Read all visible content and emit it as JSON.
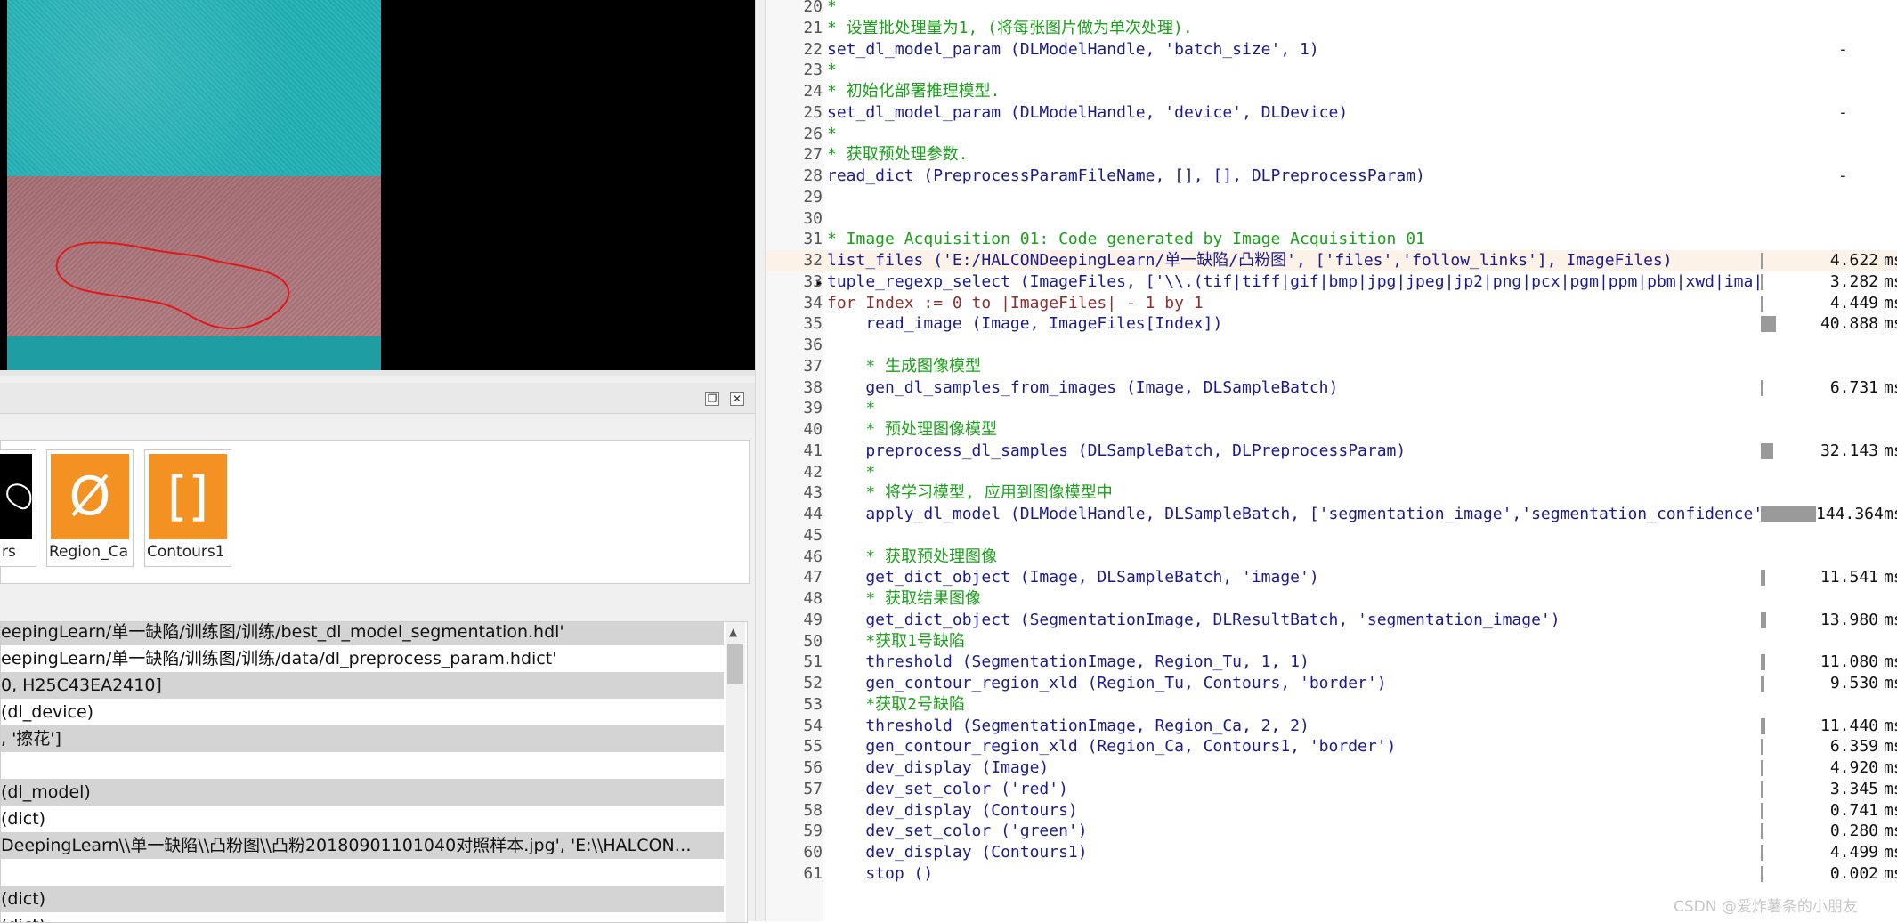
{
  "graphics_window": {
    "contour_color": "#e01818"
  },
  "variable_window": {
    "iconic_variables": [
      {
        "label": "rs"
      },
      {
        "label": "Region_Ca",
        "icon": "empty-set-icon",
        "glyph": "Ø"
      },
      {
        "label": "Contours1",
        "icon": "brackets-icon",
        "glyph": "[]"
      }
    ],
    "control_variables": [
      "eepingLearn/单一缺陷/训练图/训练/best_dl_model_segmentation.hdl'",
      "eepingLearn/单一缺陷/训练图/训练/data/dl_preprocess_param.hdict'",
      "0, H25C43EA2410]",
      " (dl_device)",
      ", '擦花']",
      "",
      " (dl_model)",
      " (dict)",
      "DeepingLearn\\\\单一缺陷\\\\凸粉图\\\\凸粉20180901101040对照样本.jpg', 'E:\\\\HALCON…",
      "",
      " (dict)",
      " (dict)"
    ]
  },
  "editor": {
    "lines": [
      {
        "n": "20",
        "text": "*",
        "kind": "comment"
      },
      {
        "n": "21",
        "text": "* 设置批处理量为1, (将每张图片做为单次处理).",
        "kind": "comment"
      },
      {
        "n": "22",
        "text": "set_dl_model_param (DLModelHandle, 'batch_size', 1)",
        "kind": "op",
        "dash": "-"
      },
      {
        "n": "23",
        "text": "*",
        "kind": "comment"
      },
      {
        "n": "24",
        "text": "* 初始化部署推理模型.",
        "kind": "comment"
      },
      {
        "n": "25",
        "text": "set_dl_model_param (DLModelHandle, 'device', DLDevice)",
        "kind": "op",
        "dash": "-"
      },
      {
        "n": "26",
        "text": "*",
        "kind": "comment"
      },
      {
        "n": "27",
        "text": "* 获取预处理参数.",
        "kind": "comment"
      },
      {
        "n": "28",
        "text": "read_dict (PreprocessParamFileName, [], [], DLPreprocessParam)",
        "kind": "op",
        "dash": "-"
      },
      {
        "n": "29",
        "text": "",
        "kind": "op"
      },
      {
        "n": "30",
        "text": "",
        "kind": "op"
      },
      {
        "n": "31",
        "text": "* Image Acquisition 01: Code generated by Image Acquisition 01",
        "kind": "comment"
      },
      {
        "n": "32",
        "text": "list_files ('E:/HALCONDeepingLearn/单一缺陷/凸粉图', ['files','follow_links'], ImageFiles)",
        "kind": "op",
        "highlight": true,
        "time": "4.622",
        "bar": 0.016
      },
      {
        "n": "33",
        "text": "tuple_regexp_select (ImageFiles, ['\\\\.(tif|tiff|gif|bmp|jpg|jpeg|jp2|png|pcx|pgm|ppm|pbm|xwd|ima|",
        "kind": "op",
        "time": "3.282",
        "bar": 0.016
      },
      {
        "n": "34",
        "text": "for Index := 0 to |ImageFiles| - 1 by 1",
        "kind": "control",
        "time": "4.449",
        "bar": 0.016
      },
      {
        "n": "35",
        "text": "    read_image (Image, ImageFiles[Index])",
        "kind": "op",
        "time": "40.888",
        "bar": 0.28
      },
      {
        "n": "36",
        "text": "",
        "kind": "op"
      },
      {
        "n": "37",
        "text": "    * 生成图像模型",
        "kind": "comment"
      },
      {
        "n": "38",
        "text": "    gen_dl_samples_from_images (Image, DLSampleBatch)",
        "kind": "op",
        "time": "6.731",
        "bar": 0.047
      },
      {
        "n": "39",
        "text": "    *",
        "kind": "comment"
      },
      {
        "n": "40",
        "text": "    * 预处理图像模型",
        "kind": "comment"
      },
      {
        "n": "41",
        "text": "    preprocess_dl_samples (DLSampleBatch, DLPreprocessParam)",
        "kind": "op",
        "time": "32.143",
        "bar": 0.22
      },
      {
        "n": "42",
        "text": "    *",
        "kind": "comment"
      },
      {
        "n": "43",
        "text": "    * 将学习模型, 应用到图像模型中",
        "kind": "comment"
      },
      {
        "n": "44",
        "text": "    apply_dl_model (DLModelHandle, DLSampleBatch, ['segmentation_image','segmentation_confidence'",
        "kind": "op",
        "time": "144.364",
        "bar": 1.0
      },
      {
        "n": "45",
        "text": "",
        "kind": "op"
      },
      {
        "n": "46",
        "text": "    * 获取预处理图像",
        "kind": "comment"
      },
      {
        "n": "47",
        "text": "    get_dict_object (Image, DLSampleBatch, 'image')",
        "kind": "op",
        "time": "11.541",
        "bar": 0.08
      },
      {
        "n": "48",
        "text": "    * 获取结果图像",
        "kind": "comment"
      },
      {
        "n": "49",
        "text": "    get_dict_object (SegmentationImage, DLResultBatch, 'segmentation_image')",
        "kind": "op",
        "time": "13.980",
        "bar": 0.097
      },
      {
        "n": "50",
        "text": "    *获取1号缺陷",
        "kind": "comment"
      },
      {
        "n": "51",
        "text": "    threshold (SegmentationImage, Region_Tu, 1, 1)",
        "kind": "op",
        "time": "11.080",
        "bar": 0.077
      },
      {
        "n": "52",
        "text": "    gen_contour_region_xld (Region_Tu, Contours, 'border')",
        "kind": "op",
        "time": "9.530",
        "bar": 0.066
      },
      {
        "n": "53",
        "text": "    *获取2号缺陷",
        "kind": "comment"
      },
      {
        "n": "54",
        "text": "    threshold (SegmentationImage, Region_Ca, 2, 2)",
        "kind": "op",
        "time": "11.440",
        "bar": 0.079
      },
      {
        "n": "55",
        "text": "    gen_contour_region_xld (Region_Ca, Contours1, 'border')",
        "kind": "op",
        "time": "6.359",
        "bar": 0.044
      },
      {
        "n": "56",
        "text": "    dev_display (Image)",
        "kind": "op",
        "time": "4.920",
        "bar": 0.034
      },
      {
        "n": "57",
        "text": "    dev_set_color ('red')",
        "kind": "op",
        "time": "3.345",
        "bar": 0.023
      },
      {
        "n": "58",
        "text": "    dev_display (Contours)",
        "kind": "op",
        "time": "0.741",
        "bar": 0.005
      },
      {
        "n": "59",
        "text": "    dev_set_color ('green')",
        "kind": "op",
        "time": "0.280",
        "bar": 0.002
      },
      {
        "n": "60",
        "text": "    dev_display (Contours1)",
        "kind": "op",
        "time": "4.499",
        "bar": 0.031
      },
      {
        "n": "61",
        "text": "    stop ()",
        "kind": "op",
        "time": "0.002",
        "bar": 0.0
      }
    ],
    "time_unit": "ms"
  },
  "watermark": "CSDN @爱炸薯条的小朋友"
}
